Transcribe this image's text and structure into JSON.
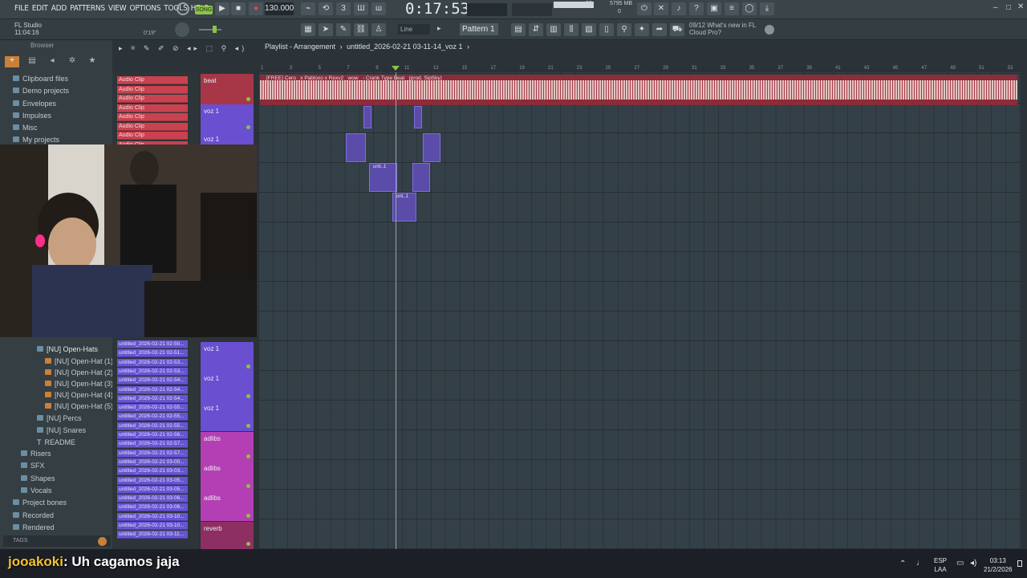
{
  "menu": [
    "FILE",
    "EDIT",
    "ADD",
    "PATTERNS",
    "VIEW",
    "OPTIONS",
    "TOOLS",
    "HELP"
  ],
  "transport": {
    "song_mode": "SONG",
    "tempo": "130.000",
    "time": "0:17:53",
    "cpu": "33",
    "memory": "5795 MB",
    "memory_sub": "0"
  },
  "hint": {
    "app": "FL Studio",
    "elapsed": "11:04:16",
    "position": "0'19\""
  },
  "toolbar2": {
    "snap": "Line",
    "pattern": "Pattern 1"
  },
  "news": {
    "line1": "09/12  What's new in FL",
    "line2": "Cloud Pro?"
  },
  "browser": {
    "title": "Browser",
    "top_items": [
      "Clipboard files",
      "Demo projects",
      "Envelopes",
      "Impulses",
      "Misc",
      "My projects"
    ],
    "mid_items": [
      "[NU] Open-Hats",
      "[NU] Open-Hat (1)",
      "[NU] Open-Hat (2)",
      "[NU] Open-Hat (3)",
      "[NU] Open-Hat (4)",
      "[NU] Open-Hat (5)",
      "[NU] Percs",
      "[NU] Snares",
      "README"
    ],
    "bottom_items": [
      "Risers",
      "SFX",
      "Shapes",
      "Vocals",
      "Project bones",
      "Recorded",
      "Rendered"
    ],
    "tags_label": "TAGS"
  },
  "clips": {
    "audio_clip_label": "Audio Clip",
    "audio_clip_count": 8,
    "recorded": [
      "untitled_2026-02-21 02-50...",
      "untitled_2026-02-21 02-51...",
      "untitled_2026-02-21 02-53...",
      "untitled_2026-02-21 02-53...",
      "untitled_2026-02-21 02-54...",
      "untitled_2026-02-21 02-54...",
      "untitled_2026-02-21 02-54...",
      "untitled_2026-02-21 02-55...",
      "untitled_2026-02-21 02-55...",
      "untitled_2026-02-21 02-55...",
      "untitled_2026-02-21 02-56...",
      "untitled_2026-02-21 02-57...",
      "untitled_2026-02-21 02-57...",
      "untitled_2026-02-21 03-00...",
      "untitled_2026-02-21 03-03...",
      "untitled_2026-02-21 03-05...",
      "untitled_2026-02-21 03-05...",
      "untitled_2026-02-21 03-06...",
      "untitled_2026-02-21 03-06...",
      "untitled_2026-02-21 03-10...",
      "untitled_2026-02-21 03-10...",
      "untitled_2026-02-21 03-11..."
    ]
  },
  "playlist": {
    "title": "Playlist - Arrangement",
    "file": "untitled_2026-02-21 03-11-14_voz 1",
    "beat_clip_label": "[FREE] Cero_ x Pabloxo x Rexv2 _wow_ - Crank Type Beat _(prod. SipSky)",
    "tracks": [
      {
        "name": "beat",
        "type": "beat"
      },
      {
        "name": "voz 1",
        "type": "voz"
      },
      {
        "name": "voz 1",
        "type": "voz"
      },
      {
        "name": "voz 1",
        "type": "voz"
      },
      {
        "name": "voz 1",
        "type": "voz"
      },
      {
        "name": "voz 1",
        "type": "voz"
      },
      {
        "name": "adlibs",
        "type": "adlib"
      },
      {
        "name": "adlibs",
        "type": "adlib"
      },
      {
        "name": "adlibs",
        "type": "adlib"
      },
      {
        "name": "reverb",
        "type": "rev"
      }
    ],
    "ruler": [
      "1",
      "3",
      "5",
      "7",
      "9",
      "11",
      "13",
      "15",
      "17",
      "19",
      "21",
      "23",
      "25",
      "27",
      "29",
      "31",
      "33",
      "35",
      "37",
      "39",
      "41",
      "43",
      "45",
      "47",
      "49",
      "51",
      "53"
    ],
    "clip_labels": [
      "unti..1",
      "unt..1"
    ]
  },
  "stream": {
    "user": "jooakoki",
    "message": ": Uh cagamos jaja"
  },
  "taskbar": {
    "lang1": "ESP",
    "lang2": "LAA",
    "time": "03:13",
    "date": "21/2/2026"
  },
  "colors": {
    "beat": "#a73747",
    "voz": "#6a4fd1",
    "adlibs": "#b43fb4",
    "reverb": "#8e2f63"
  }
}
